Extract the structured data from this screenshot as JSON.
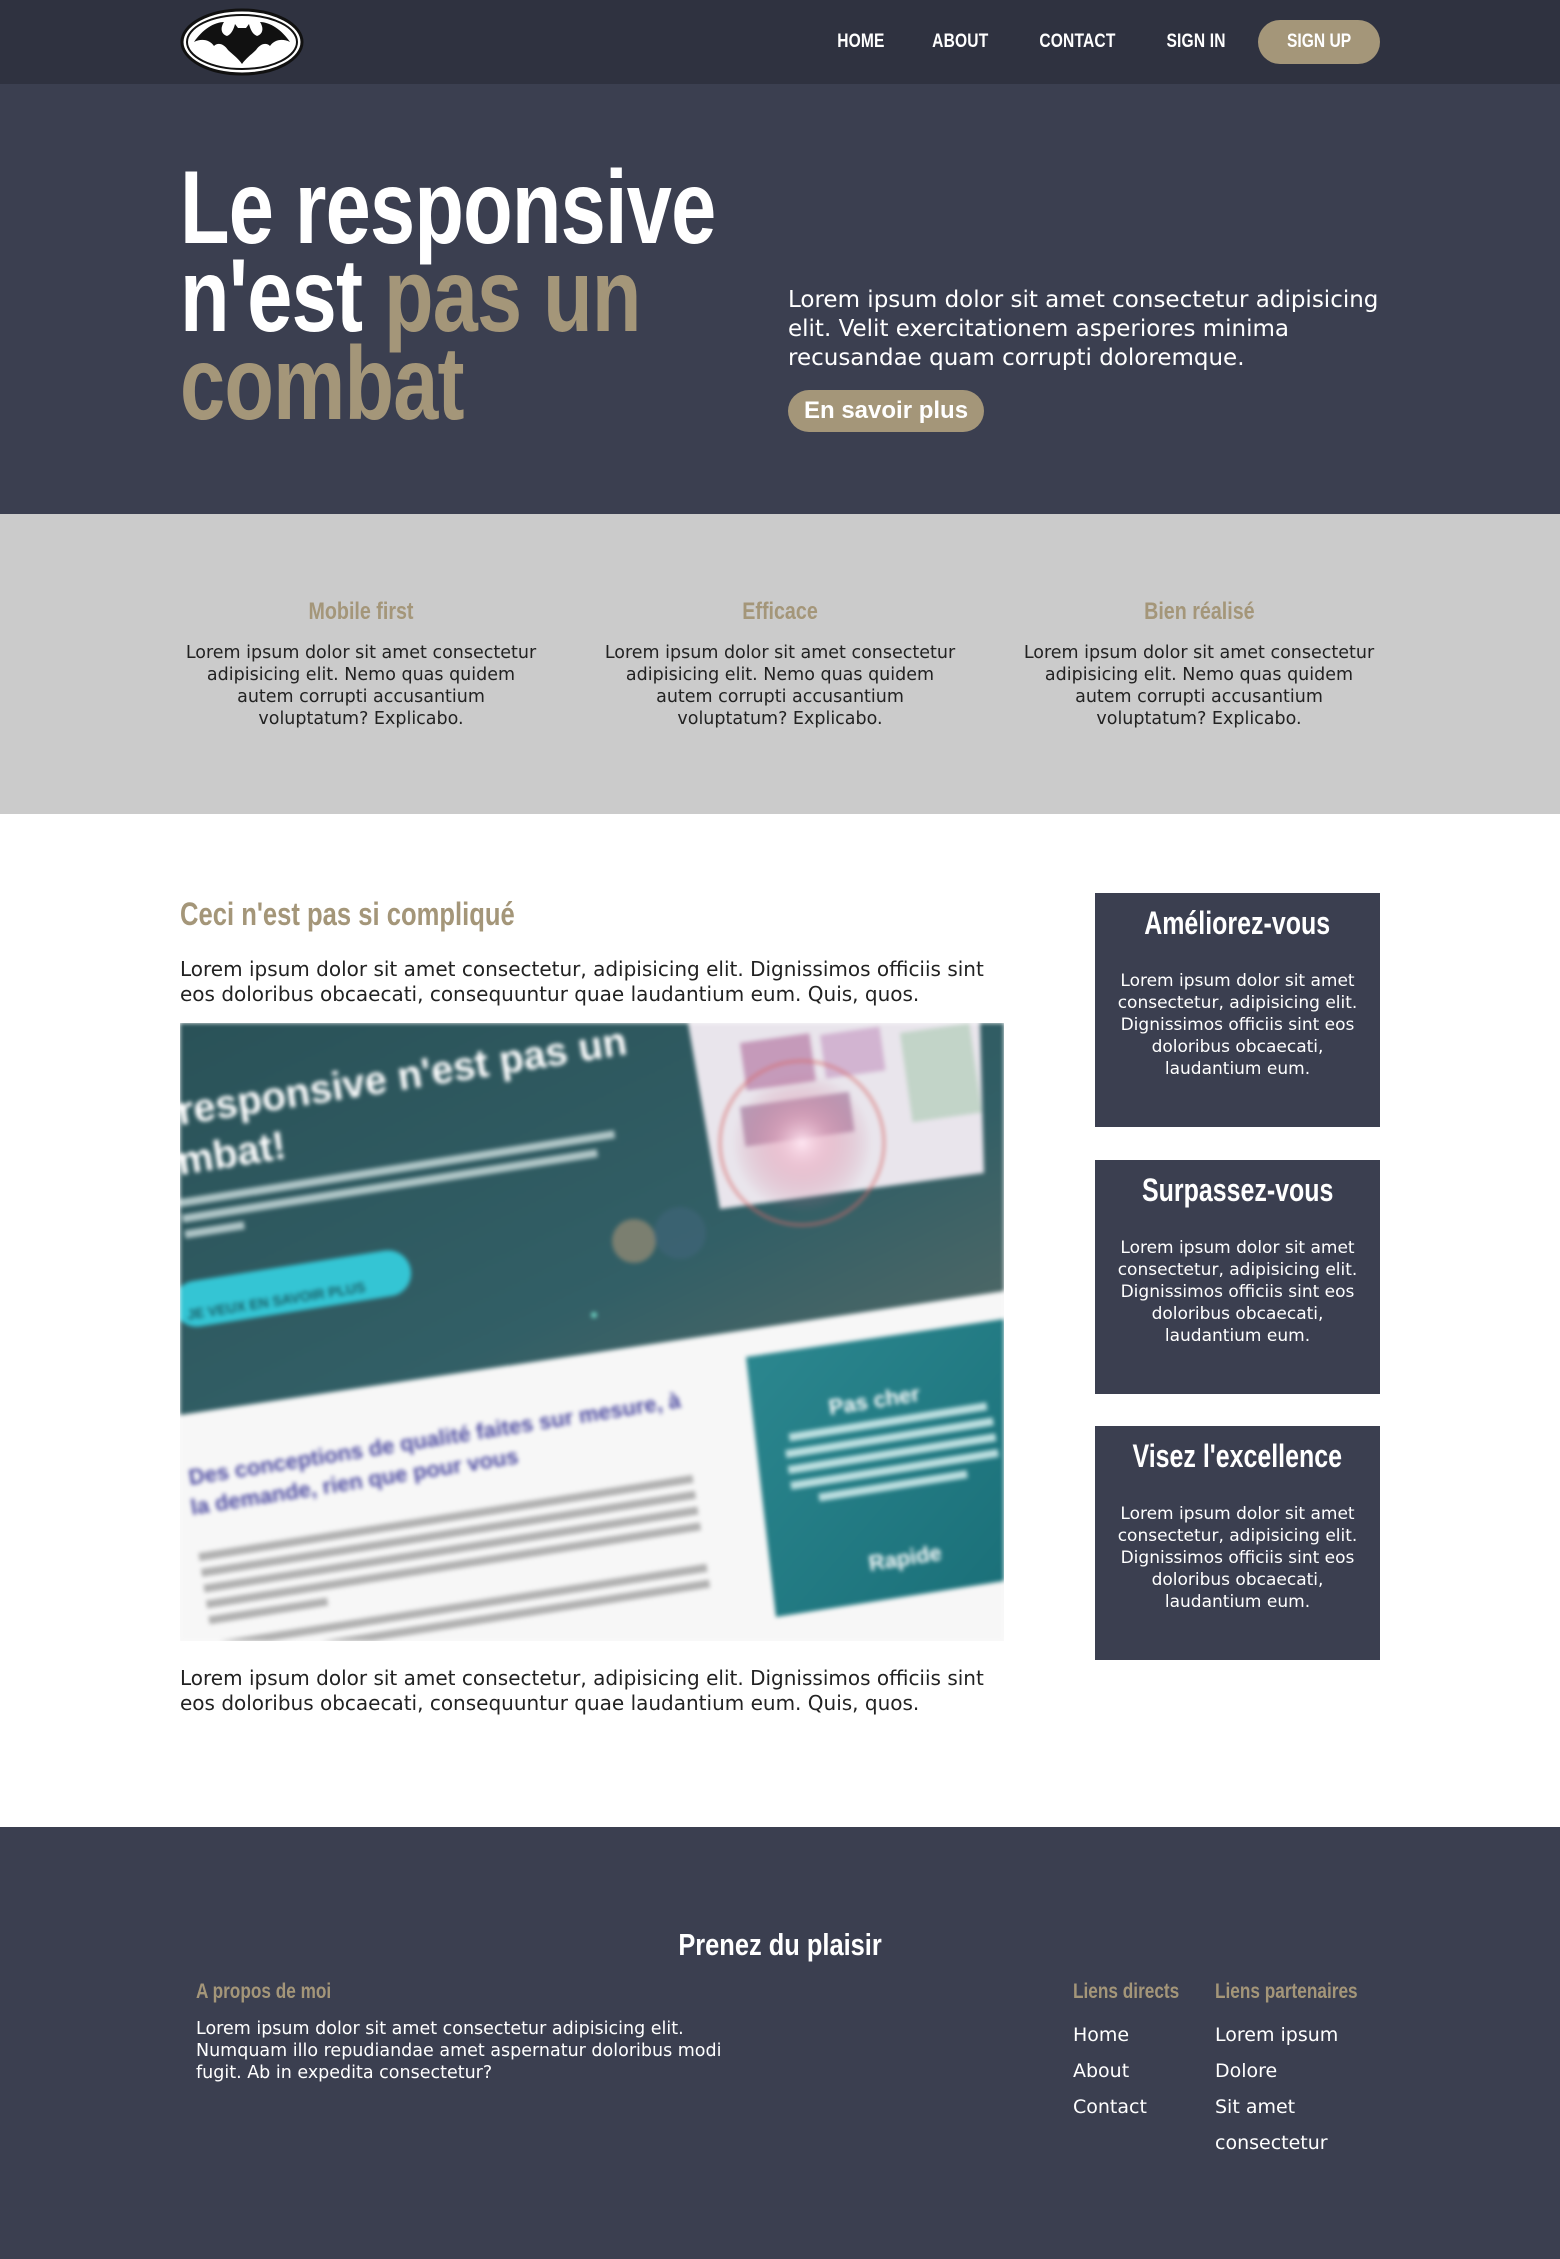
{
  "nav": {
    "logo_name": "bat-logo",
    "links": [
      "HOME",
      "ABOUT",
      "CONTACT",
      "SIGN IN"
    ],
    "signup_label": "SIGN UP"
  },
  "hero": {
    "title_line1": "Le responsive",
    "title_line2_a": "n'est ",
    "title_line2_b": "pas un",
    "title_line3": "combat",
    "text": "Lorem ipsum dolor sit amet consectetur adipisicing elit. Velit exercitationem asperiores minima recusandae quam corrupti doloremque.",
    "button_label": "En savoir plus"
  },
  "features": [
    {
      "title": "Mobile first",
      "text": "Lorem ipsum dolor sit amet consectetur adipisicing elit. Nemo quas quidem autem corrupti accusantium voluptatum? Explicabo."
    },
    {
      "title": "Efficace",
      "text": "Lorem ipsum dolor sit amet consectetur adipisicing elit. Nemo quas quidem autem corrupti accusantium voluptatum? Explicabo."
    },
    {
      "title": "Bien réalisé",
      "text": "Lorem ipsum dolor sit amet consectetur adipisicing elit. Nemo quas quidem autem corrupti accusantium voluptatum? Explicabo."
    }
  ],
  "main": {
    "title": "Ceci n'est pas si compliqué",
    "text_top": "Lorem ipsum dolor sit amet consectetur, adipisicing elit. Dignissimos officiis sint eos doloribus obcaecati, consequuntur quae laudantium eum. Quis, quos.",
    "text_bottom": "Lorem ipsum dolor sit amet consectetur, adipisicing elit. Dignissimos officiis sint eos doloribus obcaecati, consequuntur quae laudantium eum. Quis, quos.",
    "image": {
      "heading": "responsive n'est pas un mbat!",
      "button": "JE VEUX EN SAVOIR PLUS",
      "subheading": "Des conceptions de qualité faites sur mesure, à la demande, rien que pour vous",
      "card_title": "Pas cher",
      "card_footer": "Rapide"
    }
  },
  "aside": [
    {
      "title": "Améliorez-vous",
      "text": "Lorem ipsum dolor sit amet consectetur, adipisicing elit. Dignissimos officiis sint eos doloribus obcaecati, laudantium eum."
    },
    {
      "title": "Surpassez-vous",
      "text": "Lorem ipsum dolor sit amet consectetur, adipisicing elit. Dignissimos officiis sint eos doloribus obcaecati, laudantium eum."
    },
    {
      "title": "Visez l'excellence",
      "text": "Lorem ipsum dolor sit amet consectetur, adipisicing elit. Dignissimos officiis sint eos doloribus obcaecati, laudantium eum."
    }
  ],
  "footer": {
    "title": "Prenez du plaisir",
    "about_title": "A propos de moi",
    "about_text": "Lorem ipsum dolor sit amet consectetur adipisicing elit. Numquam illo repudiandae amet aspernatur doloribus modi fugit. Ab in expedita consectetur?",
    "direct_title": "Liens directs",
    "direct_links": [
      "Home",
      "About",
      "Contact"
    ],
    "partner_title": "Liens partenaires",
    "partner_links": [
      "Lorem ipsum",
      "Dolore",
      "Sit amet",
      "consectetur"
    ]
  },
  "colors": {
    "nav_bg": "#2f3240",
    "dark_bg": "#3b3f50",
    "accent": "#a49679",
    "features_bg": "#cbcbcb"
  }
}
